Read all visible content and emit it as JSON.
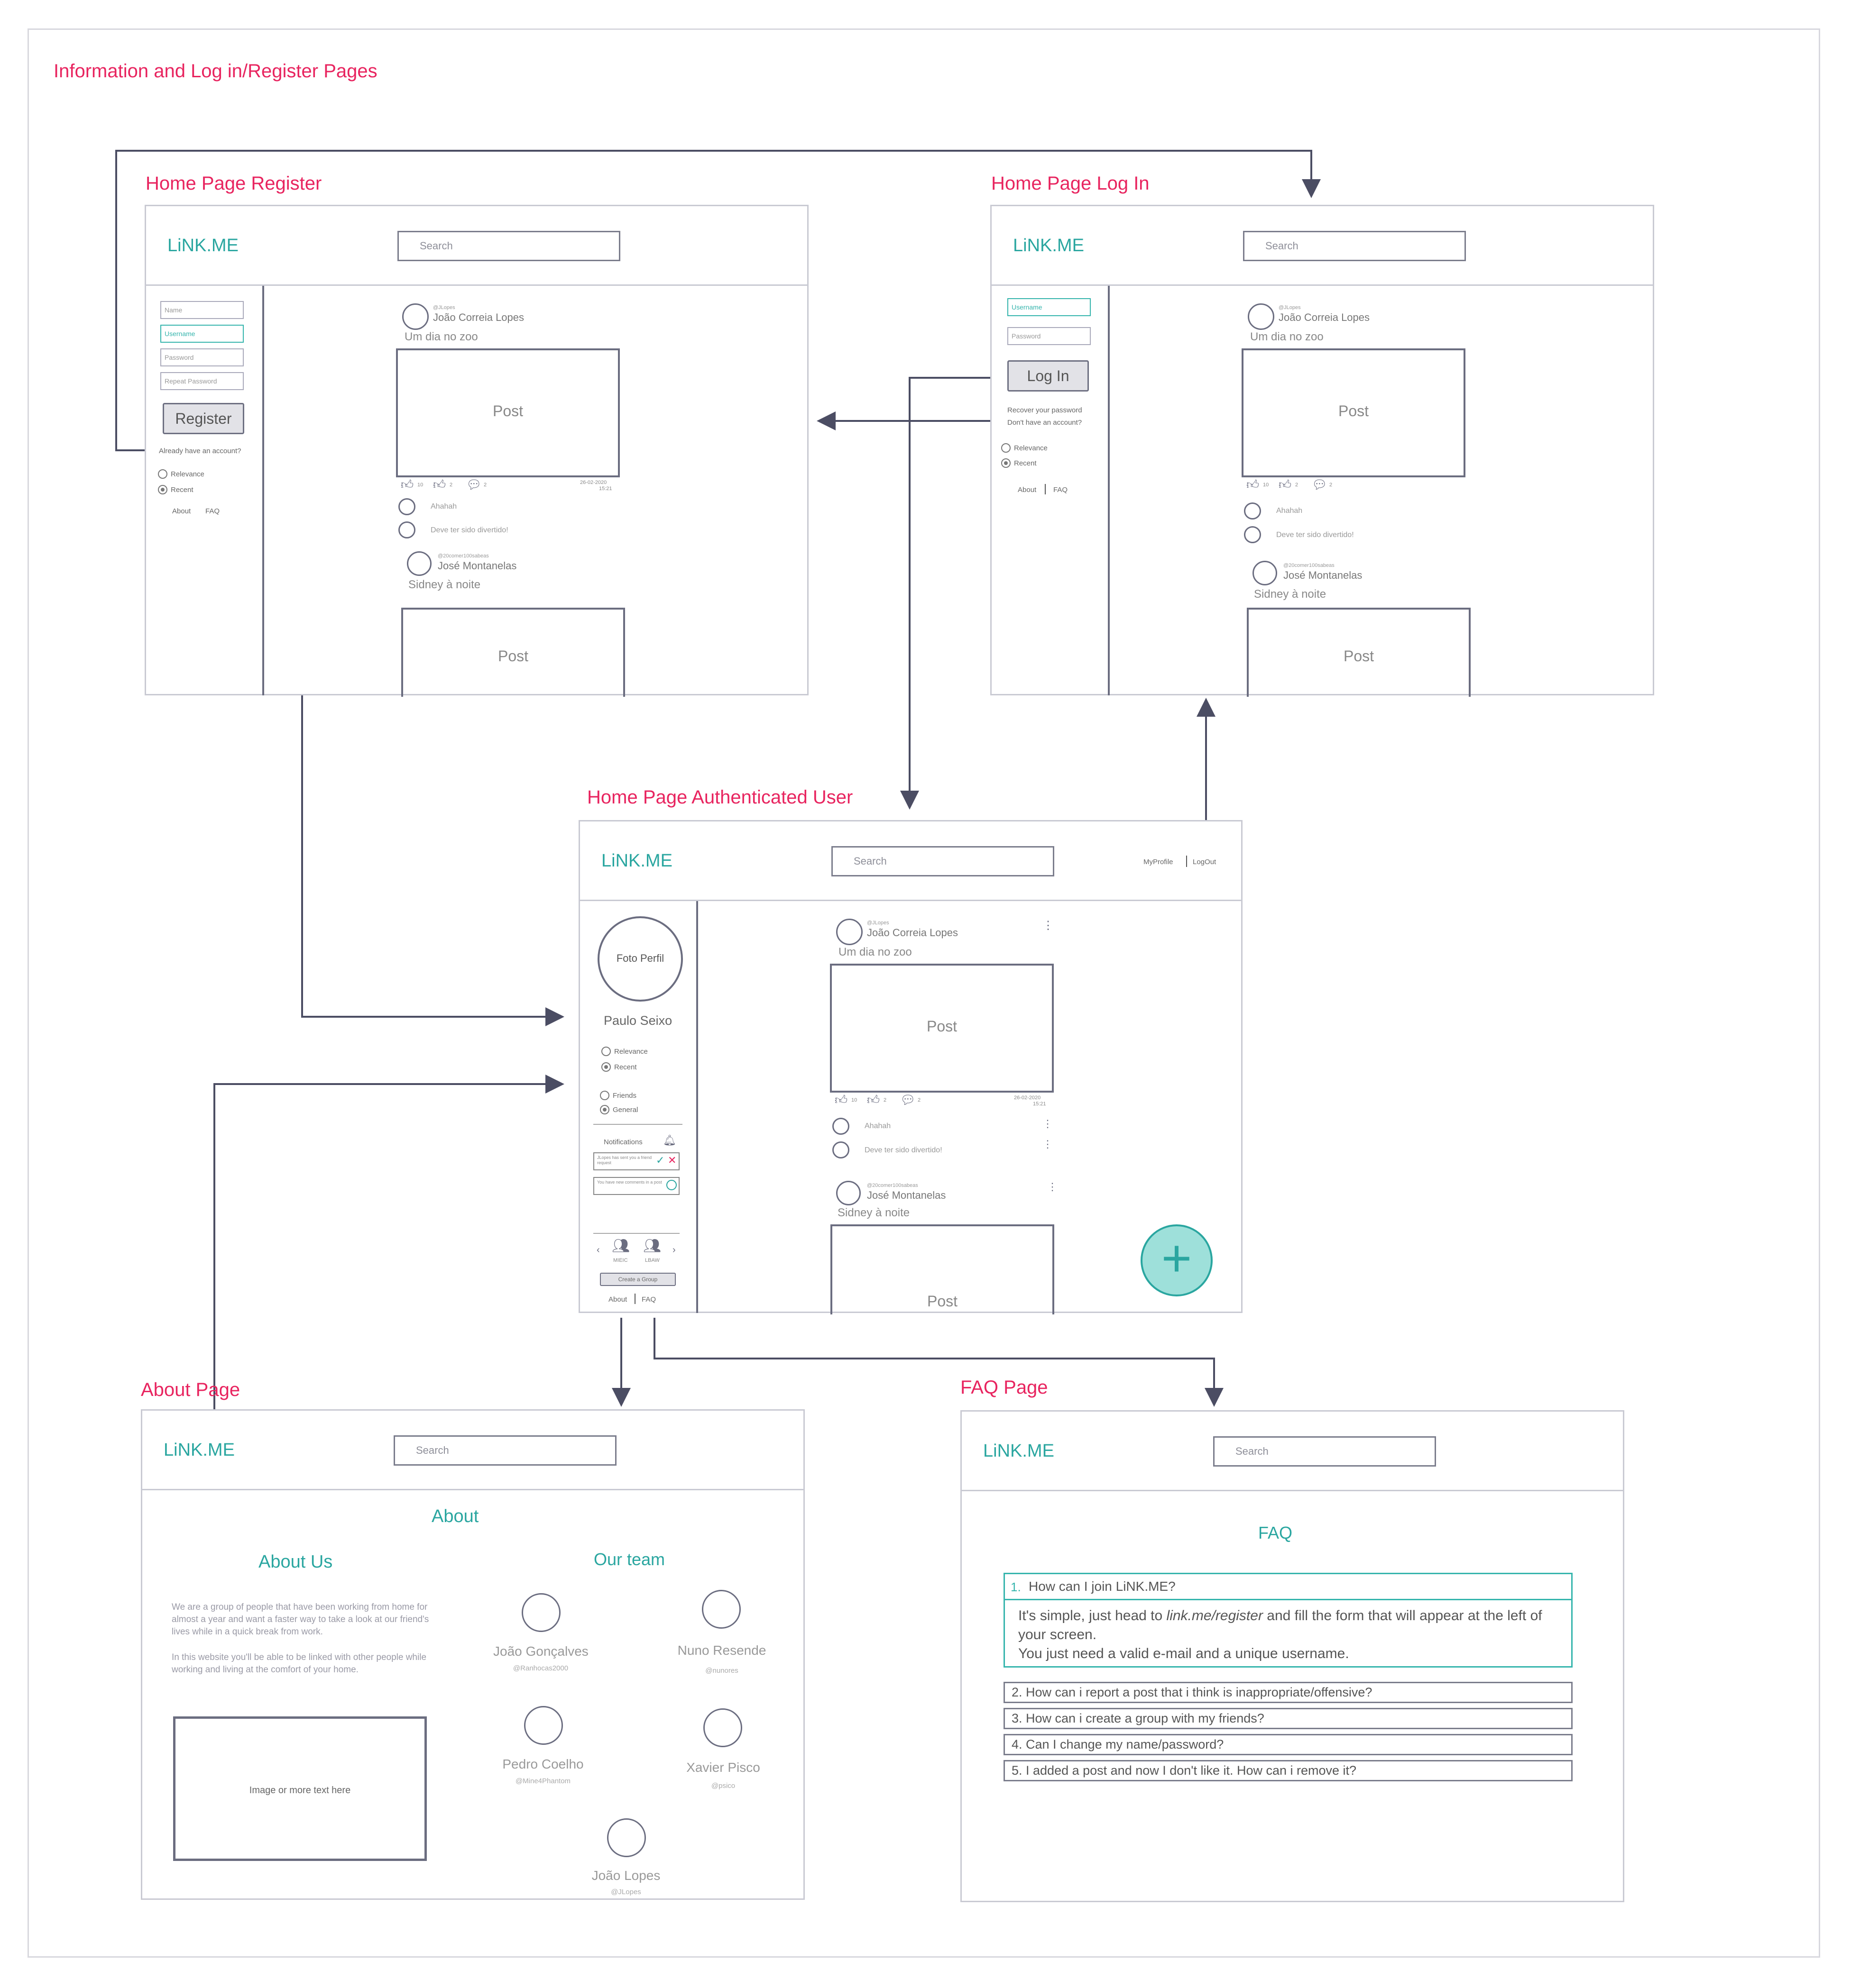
{
  "page_title": "Information and Log in/Register Pages",
  "colors": {
    "heading": "#e8245f",
    "accent": "#2aa6a0",
    "line": "#4b4d63"
  },
  "common": {
    "logo": "LiNK.ME",
    "search": "Search",
    "post_label": "Post",
    "about": "About",
    "faq": "FAQ",
    "relevance": "Relevance",
    "recent": "Recent"
  },
  "posts": {
    "p1": {
      "handle": "@JLopes",
      "name": "João Correia Lopes",
      "title": "Um dia no zoo",
      "likes": "10",
      "dislikes": "2",
      "comments": "2",
      "date": "26-02-2020",
      "time": "15:21"
    },
    "c1": "Ahahah",
    "c2": "Deve ter sido divertido!",
    "p2": {
      "handle": "@20comer100sabeas",
      "name": "José Montanelas",
      "title": "Sidney à noite"
    }
  },
  "register": {
    "heading": "Home Page Register",
    "fields": [
      "Name",
      "Username",
      "Password",
      "Repeat Password"
    ],
    "button": "Register",
    "already": "Already have an account?"
  },
  "login": {
    "heading": "Home Page Log In",
    "fields": [
      "Username",
      "Password"
    ],
    "button": "Log In",
    "recover": "Recover your password",
    "no_account": "Don't have an account?"
  },
  "auth": {
    "heading": "Home Page Authenticated User",
    "my_profile": "MyProfile",
    "logout": "LogOut",
    "photo": "Foto Perfil",
    "user": "Paulo Seixo",
    "friends": "Friends",
    "general": "General",
    "notifications": "Notifications",
    "notif1": "JLopes has sent you a friend request",
    "notif2": "You have new comments in a post",
    "groups": [
      "MIEIC",
      "LBAW"
    ],
    "create_group": "Create a Group",
    "add": "+"
  },
  "about_page": {
    "heading": "About Page",
    "title": "About",
    "about_us": "About Us",
    "text1": "We are a group of people that have been working from home for almost a year and want a faster way to take a look at our friend's lives while in a quick break from work.",
    "text2": "In this website you'll be able to be linked with other people while working and living at the comfort of your home.",
    "image_placeholder": "Image or more text here",
    "our_team": "Our team",
    "team": [
      {
        "name": "João Gonçalves",
        "handle": "@Ranhocas2000"
      },
      {
        "name": "Nuno Resende",
        "handle": "@nunores"
      },
      {
        "name": "Pedro Coelho",
        "handle": "@Mine4Phantom"
      },
      {
        "name": "Xavier Pisco",
        "handle": "@psico"
      },
      {
        "name": "João Lopes",
        "handle": "@JLopes"
      }
    ]
  },
  "faq_page": {
    "heading": "FAQ Page",
    "title": "FAQ",
    "q1_num": "1.",
    "q1": "How can I join LiNK.ME?",
    "a1_pre": "It's simple, just head to ",
    "a1_link": "link.me/register",
    "a1_post": " and fill the form that will appear at the left of your screen.",
    "a1_line2": "You just need a valid e-mail and a unique username.",
    "questions": [
      "2. How can i report a post that i think is inappropriate/offensive?",
      "3. How can i create a group with my friends?",
      "4. Can I change my name/password?",
      "5. I added a post and now I don't like it. How can i remove it?"
    ]
  }
}
